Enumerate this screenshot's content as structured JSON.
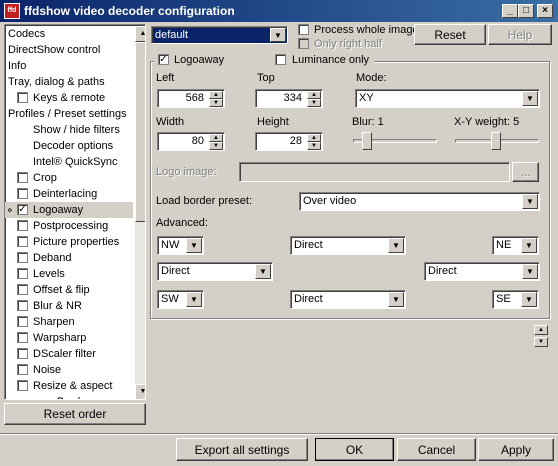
{
  "window": {
    "icon_text": "ffd",
    "title": "ffdshow video decoder configuration",
    "minimize_glyph": "_",
    "maximize_glyph": "□",
    "close_glyph": "×"
  },
  "tree": {
    "items": [
      {
        "label": "Codecs",
        "checkbox": false,
        "checked": false,
        "indent": 0
      },
      {
        "label": "DirectShow control",
        "checkbox": false,
        "checked": false,
        "indent": 0
      },
      {
        "label": "Info",
        "checkbox": false,
        "checked": false,
        "indent": 0
      },
      {
        "label": "Tray, dialog & paths",
        "checkbox": false,
        "checked": false,
        "indent": 0
      },
      {
        "label": "Keys & remote",
        "checkbox": true,
        "checked": false,
        "indent": 1
      },
      {
        "label": "Profiles / Preset settings",
        "checkbox": false,
        "checked": false,
        "indent": 0
      },
      {
        "label": "Show / hide filters",
        "checkbox": false,
        "checked": false,
        "indent": 2
      },
      {
        "label": "Decoder options",
        "checkbox": false,
        "checked": false,
        "indent": 2
      },
      {
        "label": "Intel® QuickSync",
        "checkbox": false,
        "checked": false,
        "indent": 2
      },
      {
        "label": "Crop",
        "checkbox": true,
        "checked": false,
        "indent": 1
      },
      {
        "label": "Deinterlacing",
        "checkbox": true,
        "checked": false,
        "indent": 1
      },
      {
        "label": "Logoaway",
        "checkbox": true,
        "checked": true,
        "indent": 1,
        "selected": true
      },
      {
        "label": "Postprocessing",
        "checkbox": true,
        "checked": false,
        "indent": 1
      },
      {
        "label": "Picture properties",
        "checkbox": true,
        "checked": false,
        "indent": 1
      },
      {
        "label": "Deband",
        "checkbox": true,
        "checked": false,
        "indent": 1
      },
      {
        "label": "Levels",
        "checkbox": true,
        "checked": false,
        "indent": 1
      },
      {
        "label": "Offset & flip",
        "checkbox": true,
        "checked": false,
        "indent": 1
      },
      {
        "label": "Blur & NR",
        "checkbox": true,
        "checked": false,
        "indent": 1
      },
      {
        "label": "Sharpen",
        "checkbox": true,
        "checked": false,
        "indent": 1
      },
      {
        "label": "Warpsharp",
        "checkbox": true,
        "checked": false,
        "indent": 1
      },
      {
        "label": "DScaler filter",
        "checkbox": true,
        "checked": false,
        "indent": 1
      },
      {
        "label": "Noise",
        "checkbox": true,
        "checked": false,
        "indent": 1
      },
      {
        "label": "Resize & aspect",
        "checkbox": true,
        "checked": false,
        "indent": 1
      },
      {
        "label": "Borders",
        "checkbox": false,
        "checked": false,
        "indent": 3
      }
    ],
    "reset_order_label": "Reset order"
  },
  "preset": {
    "selected": "default",
    "process_whole_image_label": "Process whole image",
    "only_right_half_label": "Only right half",
    "reset_label": "Reset",
    "help_label": "Help"
  },
  "logoaway": {
    "enable_label": "Logoaway",
    "enable_checked": true,
    "luminance_only_label": "Luminance only",
    "left_label": "Left",
    "left_value": "568",
    "top_label": "Top",
    "top_value": "334",
    "mode_label": "Mode:",
    "mode_value": "XY",
    "width_label": "Width",
    "width_value": "80",
    "height_label": "Height",
    "height_value": "28",
    "blur_label": "Blur: 1",
    "blur_level": 1,
    "xy_weight_label": "X-Y weight: 5",
    "xy_weight_level": 5,
    "logo_image_label": "Logo image:",
    "logo_image_value": "",
    "browse_label": "...",
    "load_border_preset_label": "Load border preset:",
    "load_border_preset_value": "Over video",
    "advanced_label": "Advanced:",
    "advanced": {
      "nw": "NW",
      "north": "Direct",
      "ne": "NE",
      "west": "Direct",
      "east": "Direct",
      "sw": "SW",
      "south": "Direct",
      "se": "SE"
    }
  },
  "footer": {
    "export_label": "Export all settings",
    "ok_label": "OK",
    "cancel_label": "Cancel",
    "apply_label": "Apply"
  }
}
